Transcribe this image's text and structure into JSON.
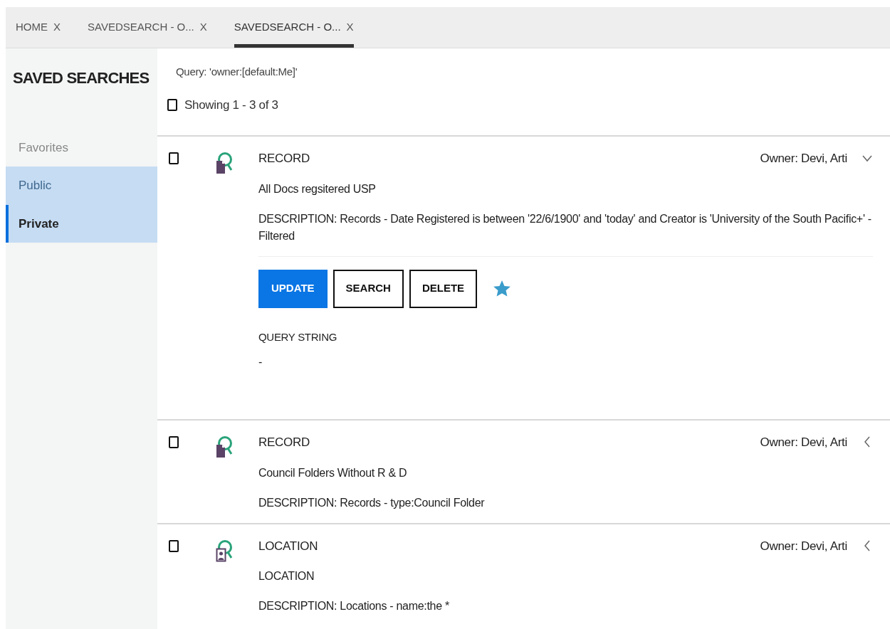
{
  "tabs": [
    {
      "label": "HOME",
      "close": "X",
      "selected": false
    },
    {
      "label": "SAVEDSEARCH - O...",
      "close": "X",
      "selected": false
    },
    {
      "label": "SAVEDSEARCH - O...",
      "close": "X",
      "selected": true
    }
  ],
  "sidebar": {
    "title": "SAVED SEARCHES",
    "items": [
      {
        "label": "Favorites",
        "highlighted": false,
        "selected": false
      },
      {
        "label": "Public",
        "highlighted": true,
        "selected": false
      },
      {
        "label": "Private",
        "highlighted": true,
        "selected": true
      }
    ]
  },
  "query": "Query: 'owner:[default:Me]'",
  "select_all": {
    "checked": false,
    "label": "Showing 1 - 3 of 3"
  },
  "results": [
    {
      "kind": "record",
      "checked": false,
      "type": "RECORD",
      "owner": "Owner: Devi, Arti",
      "expanded": true,
      "title": "All Docs regsitered USP",
      "description": "DESCRIPTION: Records - Date Registered is between '22/6/1900' and 'today' and Creator is 'University of the South Pacific+' - Filtered",
      "actions": [
        {
          "label": "UPDATE",
          "primary": true
        },
        {
          "label": "SEARCH",
          "primary": false
        },
        {
          "label": "DELETE",
          "primary": false
        }
      ],
      "favorite": true,
      "query_label": "QUERY STRING",
      "query_value": "-"
    },
    {
      "kind": "record",
      "checked": false,
      "type": "RECORD",
      "owner": "Owner: Devi, Arti",
      "expanded": false,
      "title": "Council Folders Without R & D",
      "description": "DESCRIPTION: Records - type:Council Folder"
    },
    {
      "kind": "location",
      "checked": false,
      "type": "LOCATION",
      "owner": "Owner: Devi, Arti",
      "expanded": false,
      "title": "LOCATION",
      "description": "DESCRIPTION: Locations - name:the *"
    }
  ]
}
